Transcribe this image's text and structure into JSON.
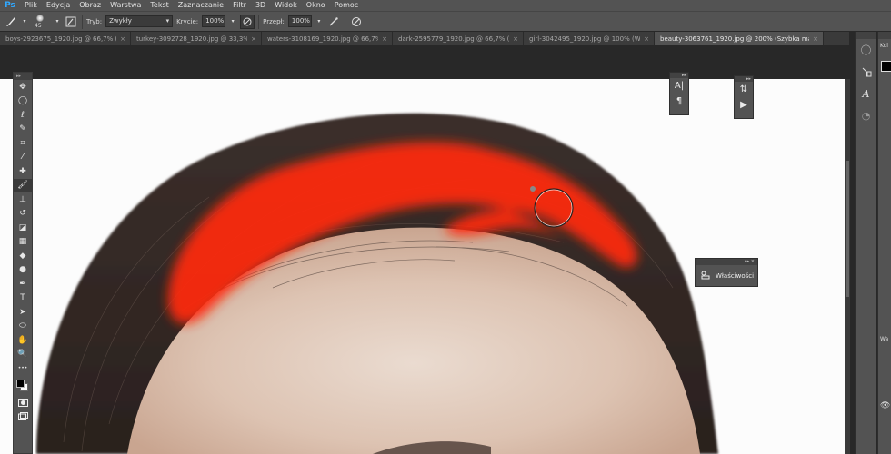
{
  "app": {
    "logo": "Ps"
  },
  "menu": [
    "Plik",
    "Edycja",
    "Obraz",
    "Warstwa",
    "Tekst",
    "Zaznaczanie",
    "Filtr",
    "3D",
    "Widok",
    "Okno",
    "Pomoc"
  ],
  "options": {
    "brush_size": "45",
    "mode_label": "Tryb:",
    "mode_value": "Zwykły",
    "opacity_label": "Krycie:",
    "opacity_value": "100%",
    "flow_label": "Przepł:",
    "flow_value": "100%"
  },
  "tabs": [
    {
      "label": "boys-2923675_1920.jpg @ 66,7% (RGB...",
      "active": false
    },
    {
      "label": "turkey-3092728_1920.jpg @ 33,3% (ed...",
      "active": false
    },
    {
      "label": "waters-3108169_1920.jpg @ 66,7% (R...",
      "active": false
    },
    {
      "label": "dark-2595779_1920.jpg @ 66,7% (RGB...",
      "active": false
    },
    {
      "label": "girl-3042495_1920.jpg @ 100% (Warst...",
      "active": false
    },
    {
      "label": "beauty-3063761_1920.jpg @ 200% (Szybka maska/8) *",
      "active": true
    }
  ],
  "tools": [
    {
      "name": "move-tool",
      "glyph": "✥"
    },
    {
      "name": "marquee-tool",
      "glyph": "◯"
    },
    {
      "name": "lasso-tool",
      "glyph": "ℓ"
    },
    {
      "name": "quick-select-tool",
      "glyph": "✎"
    },
    {
      "name": "crop-tool",
      "glyph": "⌗"
    },
    {
      "name": "eyedropper-tool",
      "glyph": "⁄"
    },
    {
      "name": "healing-brush-tool",
      "glyph": "✚"
    },
    {
      "name": "brush-tool",
      "glyph": "🖌"
    },
    {
      "name": "clone-stamp-tool",
      "glyph": "⊥"
    },
    {
      "name": "history-brush-tool",
      "glyph": "↺"
    },
    {
      "name": "eraser-tool",
      "glyph": "◪"
    },
    {
      "name": "gradient-tool",
      "glyph": "▦"
    },
    {
      "name": "blur-tool",
      "glyph": "◆"
    },
    {
      "name": "dodge-tool",
      "glyph": "●"
    },
    {
      "name": "pen-tool",
      "glyph": "✒"
    },
    {
      "name": "type-tool",
      "glyph": "T"
    },
    {
      "name": "path-select-tool",
      "glyph": "➤"
    },
    {
      "name": "ellipse-tool",
      "glyph": "⬭"
    },
    {
      "name": "hand-tool",
      "glyph": "✋"
    },
    {
      "name": "zoom-tool",
      "glyph": "🔍"
    },
    {
      "name": "more-tools",
      "glyph": "•••"
    }
  ],
  "panels": {
    "character": {
      "glyph_a": "A|",
      "glyph_b": "¶"
    },
    "actions": {
      "glyph_a": "⇅",
      "glyph_b": "▶"
    },
    "properties": {
      "label": "Właściwości"
    }
  },
  "right_dock": {
    "panel_label_top": "Kol",
    "panel_label_mid": "Wa"
  },
  "colors": {
    "mask_overlay": "#ff2a10",
    "chrome": "#535353",
    "canvas_bg": "#fcfcfc"
  }
}
